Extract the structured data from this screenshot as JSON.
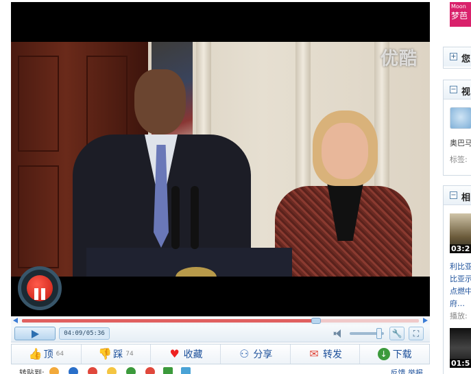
{
  "player": {
    "watermark": "优酷",
    "time_display": "04:09/05:36",
    "progress_fraction": 0.741,
    "volume_fraction": 0.85
  },
  "actions": [
    {
      "label": "顶",
      "count": "64",
      "icon": "thumbs-up-icon"
    },
    {
      "label": "踩",
      "count": "74",
      "icon": "thumbs-down-icon"
    },
    {
      "label": "收藏",
      "count": "",
      "icon": "heart-icon"
    },
    {
      "label": "分享",
      "count": "",
      "icon": "share-icon"
    },
    {
      "label": "转发",
      "count": "",
      "icon": "forward-icon"
    },
    {
      "label": "下载",
      "count": "",
      "icon": "download-icon"
    }
  ],
  "bottom_bar": {
    "label": "转贴到:",
    "right_links": "反馈 举报"
  },
  "sidebar": {
    "ad": {
      "line1": "Moon",
      "line2": "梦芭"
    },
    "box1": {
      "title": "您"
    },
    "box2": {
      "title": "视",
      "user": "奥巴马",
      "tags": "标签:"
    },
    "box3": {
      "title": "相",
      "item1": {
        "duration": "03:2",
        "title_lines": [
          "利比亚",
          "比亚示",
          "点燃中",
          "府…"
        ],
        "plays": "播放:"
      },
      "item2": {
        "duration": "01:5"
      }
    }
  },
  "colors": {
    "accent": "#1b4f9a",
    "seek_played": "#e06060",
    "ad_bg": "#d9216b"
  }
}
